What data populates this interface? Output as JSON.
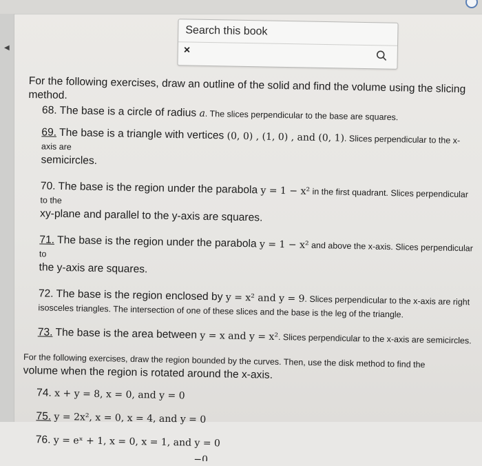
{
  "toolbar": {
    "search_placeholder": "Search this book",
    "close_symbol": "×"
  },
  "intro1": {
    "text_a": "For the following exercises, draw an outline of the solid and find the volume using the slicing method."
  },
  "ex68": {
    "number": "68.",
    "text_a": "The base is a circle of radius ",
    "var": "a",
    "text_b": ". The slices perpendicular to the base are squares."
  },
  "ex69": {
    "number": "69.",
    "text_a": "The base is a triangle with vertices ",
    "math": "(0, 0) , (1, 0) , and (0, 1)",
    "text_b": ". Slices perpendicular to the x-axis are",
    "text_c": "semicircles."
  },
  "ex70": {
    "number": "70.",
    "text_a": "The base is the region under the parabola ",
    "math": "y = 1 − x²",
    "text_b": " in the first quadrant. Slices perpendicular to the",
    "text_c": "xy-plane and parallel to the y-axis are squares."
  },
  "ex71": {
    "number": "71.",
    "text_a": "The base is the region under the parabola ",
    "math": "y = 1 − x²",
    "text_b": " and above the x-axis. Slices perpendicular to",
    "text_c": "the y-axis are squares."
  },
  "ex72": {
    "number": "72.",
    "text_a": "The base is the region enclosed by ",
    "math": "y = x² and y = 9",
    "text_b": ". Slices perpendicular to the x-axis are right",
    "text_c": "isosceles triangles. The intersection of one of these slices and the base is the leg of the triangle."
  },
  "ex73": {
    "number": "73.",
    "text_a": "The base is the area between ",
    "math": "y = x and y = x²",
    "text_b": ". Slices perpendicular to the x-axis are semicircles."
  },
  "intro2": {
    "text_a": "For the following exercises, draw the region bounded by the curves. Then, use the disk method to find the",
    "text_b": "volume when the region is rotated around the x-axis."
  },
  "ex74": {
    "number": "74.",
    "math": "x + y = 8, x = 0, and y = 0"
  },
  "ex75": {
    "number": "75.",
    "math": "y = 2x², x = 0, x = 4, and y = 0"
  },
  "ex76": {
    "number": "76.",
    "math": "y = eˣ + 1, x = 0, x = 1, and y = 0"
  },
  "ex77_partial": {
    "math": "−0"
  }
}
